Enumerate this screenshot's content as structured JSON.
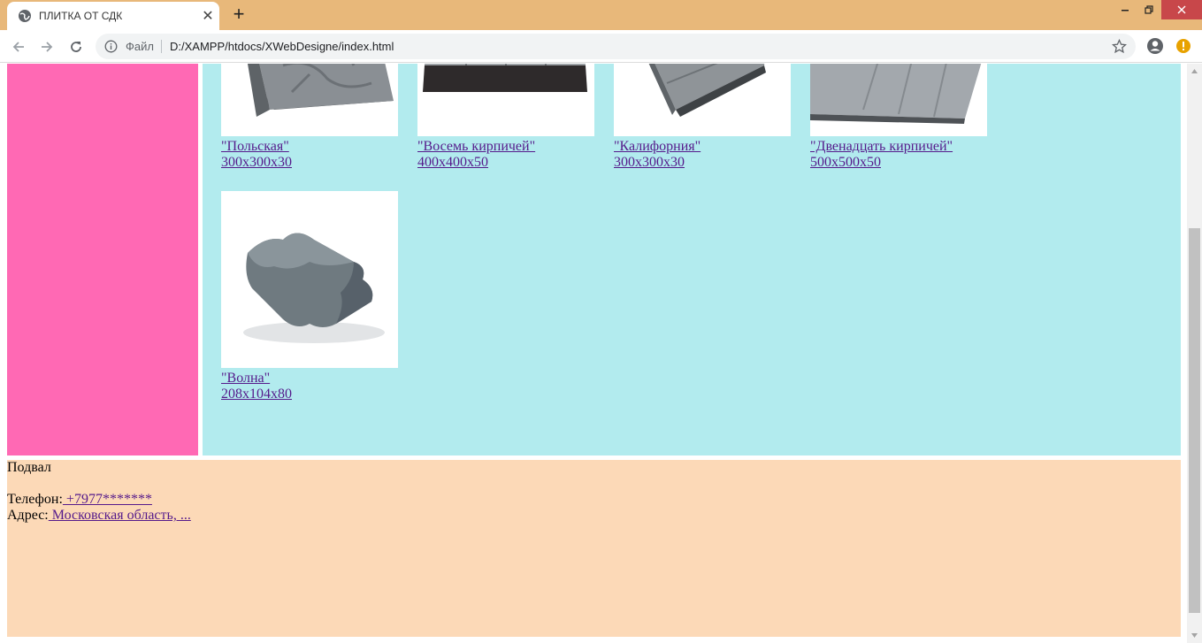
{
  "browser": {
    "tab_title": "ПЛИТКА ОТ СДК",
    "tab_close": "✕",
    "new_tab": "+",
    "omnibox": {
      "scheme_label": "Файл",
      "url": "D:/XAMPP/htdocs/XWebDesigne/index.html"
    },
    "tab_color": "#e8b87a",
    "close_button_color": "#c8474a"
  },
  "page": {
    "colors": {
      "sidebar": "#ff69b4",
      "content": "#b2ebee",
      "footer": "#fcd9b7",
      "link": "#551a8b"
    },
    "products": [
      {
        "name": "\"Польская\"",
        "size": "300x300x30",
        "image": "polish-tile-icon"
      },
      {
        "name": "\"Восемь кирпичей\"",
        "size": "400x400x50",
        "image": "eight-bricks-tile-icon"
      },
      {
        "name": "\"Калифорния\"",
        "size": "300x300x30",
        "image": "california-tile-icon"
      },
      {
        "name": "\"Двенадцать кирпичей\"",
        "size": "500x500x50",
        "image": "twelve-bricks-tile-icon"
      },
      {
        "name": "\"Волна\"",
        "size": "208x104x80",
        "image": "wave-paver-icon"
      }
    ],
    "footer": {
      "title": "Подвал",
      "phone_label": "Телефон:",
      "phone_value": " +7977*******",
      "address_label": "Адрес:",
      "address_value": " Московская область, ..."
    }
  }
}
